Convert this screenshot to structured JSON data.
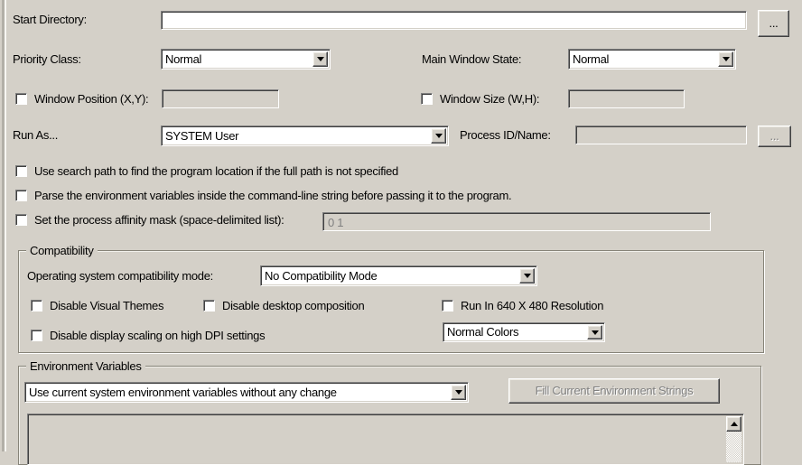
{
  "colors": {
    "window_bg": "#d4d0c8",
    "field_bg": "#ffffff",
    "disabled_text": "#808080"
  },
  "form": {
    "start_directory": {
      "label": "Start Directory:",
      "value": "",
      "browse": "..."
    },
    "priority_class": {
      "label": "Priority Class:",
      "selected": "Normal"
    },
    "main_window_state": {
      "label": "Main Window State:",
      "selected": "Normal"
    },
    "window_position": {
      "label": "Window Position (X,Y):",
      "checked": false,
      "value": ""
    },
    "window_size": {
      "label": "Window Size (W,H):",
      "checked": false,
      "value": ""
    },
    "run_as": {
      "label": "Run As...",
      "selected": "SYSTEM User"
    },
    "process_id_name": {
      "label": "Process ID/Name:",
      "value": "",
      "browse": "..."
    },
    "use_search_path": {
      "label": "Use search path to find the program location if the full path is not specified",
      "checked": false
    },
    "parse_env_vars": {
      "label": "Parse the environment variables inside the command-line string before passing it to the program.",
      "checked": false
    },
    "affinity_mask": {
      "label": "Set the process affinity mask (space-delimited list):",
      "checked": false,
      "value": "0 1"
    }
  },
  "compatibility": {
    "title": "Compatibility",
    "os_mode": {
      "label": "Operating system compatibility mode:",
      "selected": "No Compatibility Mode"
    },
    "disable_visual_themes": {
      "label": "Disable Visual Themes",
      "checked": false
    },
    "disable_desktop_composition": {
      "label": "Disable desktop composition",
      "checked": false
    },
    "run_640_480": {
      "label": "Run In 640 X 480 Resolution",
      "checked": false
    },
    "disable_dpi_scaling": {
      "label": "Disable display scaling on high DPI settings",
      "checked": false
    },
    "color_mode": {
      "selected": "Normal Colors"
    }
  },
  "environment": {
    "title": "Environment Variables",
    "mode": {
      "selected": "Use current system environment variables without any change"
    },
    "fill_button": {
      "label": "Fill Current Environment Strings",
      "enabled": false
    },
    "content": ""
  }
}
